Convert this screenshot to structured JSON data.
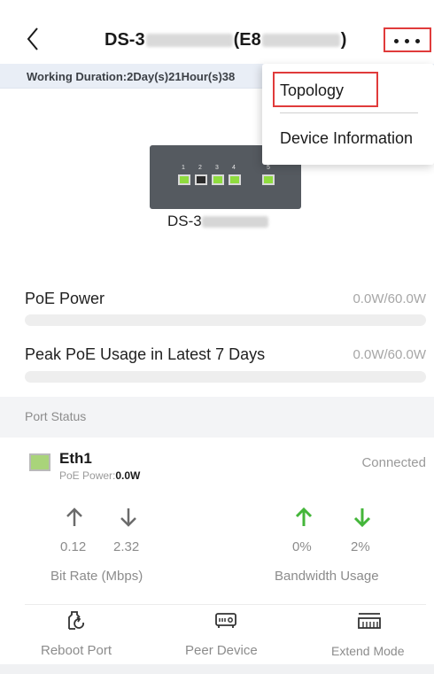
{
  "header": {
    "title_prefix": "DS-3",
    "title_suffix": "(E8",
    "title_close": ")",
    "working_duration": "Working Duration:2Day(s)21Hour(s)38"
  },
  "menu": {
    "items": [
      {
        "label": "Topology"
      },
      {
        "label": "Device Information"
      }
    ]
  },
  "device": {
    "label_prefix": "DS-3",
    "ports": [
      "1",
      "2",
      "3",
      "4",
      "5"
    ]
  },
  "poe": {
    "power_label": "PoE Power",
    "power_value": "0.0W/60.0W",
    "power_fraction": 0.0,
    "peak_label": "Peak PoE Usage in Latest 7 Days",
    "peak_value": "0.0W/60.0W",
    "peak_fraction": 0.0
  },
  "port_status": {
    "title": "Port Status",
    "port": {
      "name": "Eth1",
      "poe_label": "PoE Power:",
      "poe_value": "0.0W",
      "status": "Connected"
    },
    "bit_rate": {
      "up": "0.12",
      "down": "2.32",
      "caption": "Bit Rate (Mbps)"
    },
    "bandwidth": {
      "up": "0%",
      "down": "2%",
      "caption": "Bandwidth Usage"
    }
  },
  "actions": [
    {
      "label": "Reboot Port",
      "icon": "reboot-icon"
    },
    {
      "label": "Peer Device",
      "icon": "peer-device-icon"
    },
    {
      "label": "Extend Mode",
      "icon": "extend-mode-icon"
    }
  ],
  "colors": {
    "highlight": "#e03b3b",
    "port_active": "#8fdc3f",
    "bandwidth_arrow": "#44b63a",
    "working_strip": "#e9eef6"
  }
}
